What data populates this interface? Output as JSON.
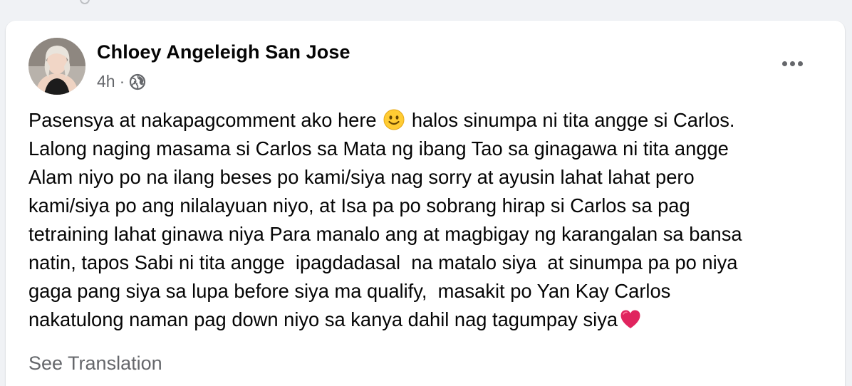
{
  "post": {
    "author_name": "Chloey Angeleigh San Jose",
    "timestamp": "4h",
    "separator": "·",
    "privacy_icon": "globe-icon",
    "more_icon": "more-horizontal-icon",
    "lines": {
      "l1a": "Pasensya at nakapagcomment ako here",
      "l1b": "halos sinumpa ni tita angge si Carlos.",
      "l2": "Lalong naging masama si Carlos sa Mata ng ibang Tao sa ginagawa ni tita angge",
      "l3": "Alam niyo po na ilang beses po kami/siya nag sorry at ayusin lahat lahat pero",
      "l4": "kami/siya po ang nilalayuan niyo, at Isa pa po sobrang hirap si Carlos sa pag",
      "l5": "tetraining lahat ginawa niya Para manalo ang at magbigay ng karangalan sa bansa",
      "l6": "natin, tapos Sabi ni tita angge  ipagdadasal  na matalo siya  at sinumpa pa po niya",
      "l7": "gaga pang siya sa lupa before siya ma qualify,  masakit po Yan Kay Carlos",
      "l8": "nakatulong naman pag down niyo sa kanya dahil nag tagumpay siya"
    },
    "emojis": {
      "smile": "slightly-smiling-face-emoji",
      "heart": "red-heart-emoji"
    },
    "see_translation_label": "See Translation"
  },
  "colors": {
    "background": "#f0f2f5",
    "card": "#ffffff",
    "primary_text": "#050505",
    "secondary_text": "#65676b",
    "heart_red": "#e0245e",
    "emoji_yellow": "#ffcc33"
  }
}
